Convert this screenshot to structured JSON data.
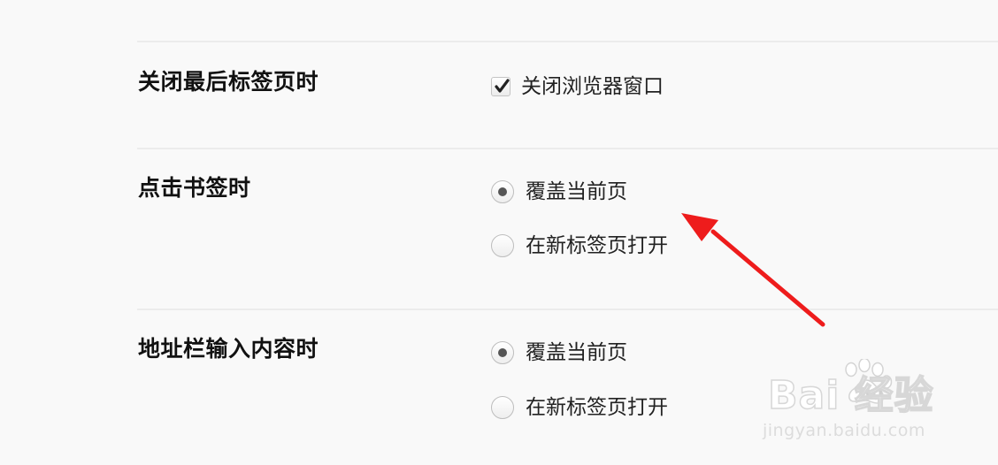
{
  "settings": {
    "close_last_tab": {
      "label": "关闭最后标签页时",
      "option_label": "关闭浏览器窗口",
      "checked": true
    },
    "bookmark_click": {
      "label": "点击书签时",
      "options": [
        {
          "label": "覆盖当前页",
          "selected": true
        },
        {
          "label": "在新标签页打开",
          "selected": false
        }
      ]
    },
    "address_bar_input": {
      "label": "地址栏输入内容时",
      "options": [
        {
          "label": "覆盖当前页",
          "selected": true
        },
        {
          "label": "在新标签页打开",
          "selected": false
        }
      ]
    }
  },
  "annotation": {
    "arrow_color": "#ee1c1c"
  },
  "watermark": {
    "brand": "Bai  经验",
    "url": "jingyan.baidu.com"
  },
  "colors": {
    "background": "#f9f9f9",
    "divider": "#ececec",
    "text": "#222222"
  }
}
